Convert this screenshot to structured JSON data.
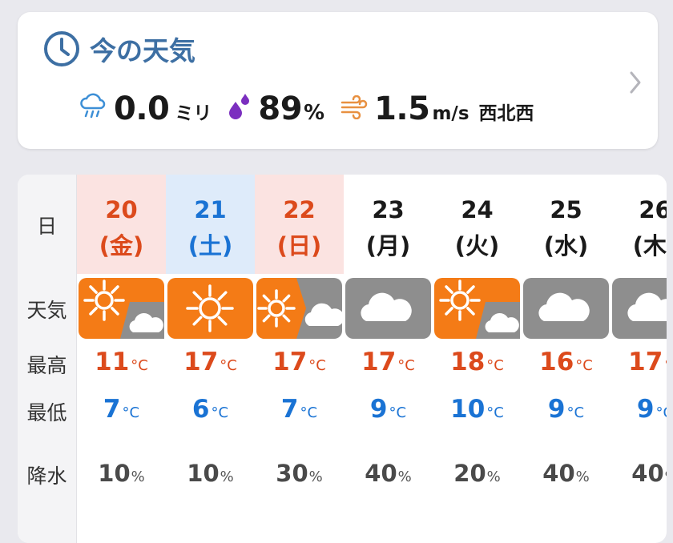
{
  "now": {
    "title": "今の天気",
    "rain_value": "0.0",
    "rain_unit": "ミリ",
    "humidity_value": "89",
    "humidity_unit": "%",
    "wind_value": "1.5",
    "wind_unit": "m/s",
    "wind_dir": "西北西"
  },
  "labels": {
    "day": "日",
    "weather": "天気",
    "high": "最高",
    "low": "最低",
    "precip": "降水"
  },
  "temp_unit": "°C",
  "precip_unit": "%",
  "days": [
    {
      "num": "20",
      "wd": "(金)",
      "icon": "sun-then-cloud",
      "hi": "11",
      "lo": "7",
      "precip": "10",
      "bg": "#fbe3e1",
      "color": "#dc4a1c"
    },
    {
      "num": "21",
      "wd": "(土)",
      "icon": "sun",
      "hi": "17",
      "lo": "6",
      "precip": "10",
      "bg": "#deebfa",
      "color": "#1a73d4"
    },
    {
      "num": "22",
      "wd": "(日)",
      "icon": "sun-cloud-split",
      "hi": "17",
      "lo": "7",
      "precip": "30",
      "bg": "#fbe3e1",
      "color": "#dc4a1c"
    },
    {
      "num": "23",
      "wd": "(月)",
      "icon": "cloud",
      "hi": "17",
      "lo": "9",
      "precip": "40",
      "bg": "#ffffff",
      "color": "#1a1a1a"
    },
    {
      "num": "24",
      "wd": "(火)",
      "icon": "sun-then-cloud",
      "hi": "18",
      "lo": "10",
      "precip": "20",
      "bg": "#ffffff",
      "color": "#1a1a1a"
    },
    {
      "num": "25",
      "wd": "(水)",
      "icon": "cloud",
      "hi": "16",
      "lo": "9",
      "precip": "40",
      "bg": "#ffffff",
      "color": "#1a1a1a"
    },
    {
      "num": "26",
      "wd": "(木)",
      "icon": "cloud",
      "hi": "17",
      "lo": "9",
      "precip": "40",
      "bg": "#ffffff",
      "color": "#1a1a1a"
    }
  ],
  "colors": {
    "title_blue": "#3d6fa3",
    "sun_orange": "#f47b16",
    "cloud_gray": "#8e8e8e",
    "high_red": "#dc4a1c",
    "low_blue": "#1a73d4",
    "humidity_purple": "#7b2fbf",
    "wind_orange": "#e89040"
  }
}
